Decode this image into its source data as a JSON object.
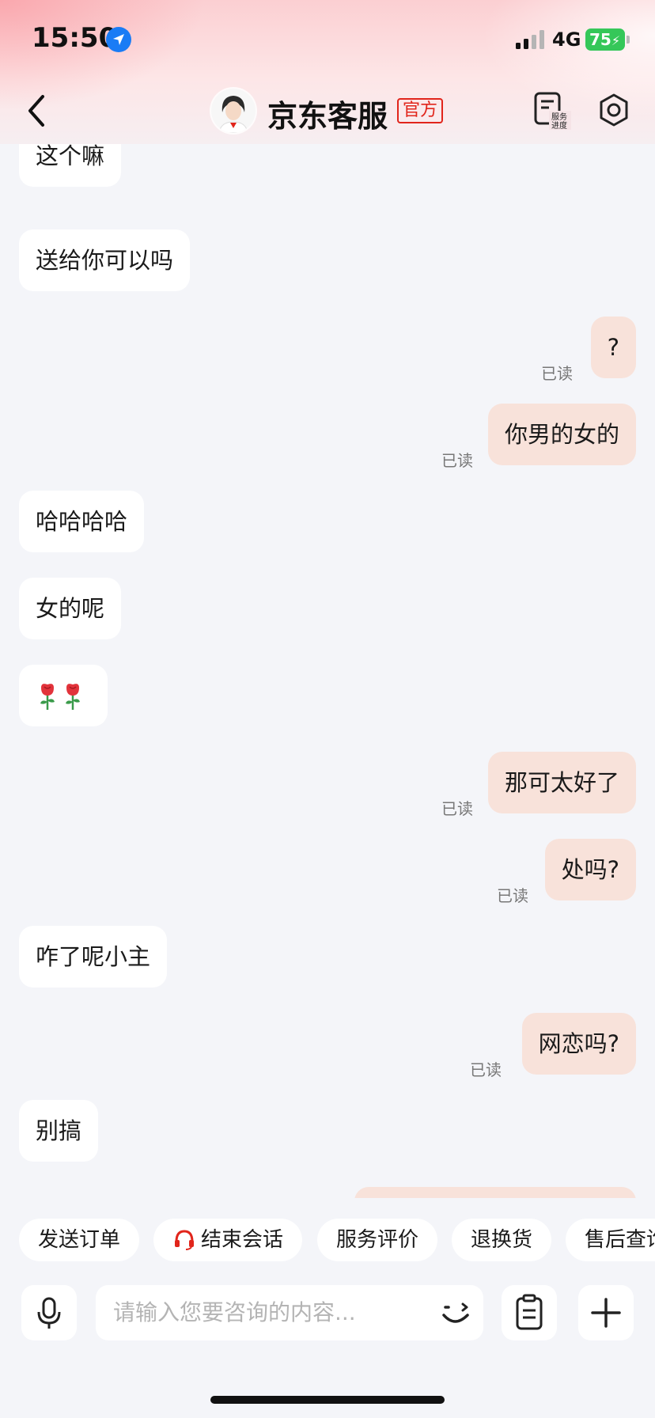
{
  "status_bar": {
    "time": "15:50",
    "network": "4G",
    "battery": "75"
  },
  "header": {
    "title": "京东客服",
    "badge": "官方"
  },
  "messages": [
    {
      "text": "这个嘛"
    },
    {
      "text": "送给你可以吗"
    },
    {
      "text": "?",
      "read": "已读"
    },
    {
      "text": "你男的女的",
      "read": "已读"
    },
    {
      "text": "哈哈哈哈"
    },
    {
      "text": "女的呢"
    },
    {
      "text": "那可太好了",
      "read": "已读"
    },
    {
      "text": "处吗?",
      "read": "已读"
    },
    {
      "text": "咋了呢小主"
    },
    {
      "text": "网恋吗?",
      "read": "已读"
    },
    {
      "text": "别搞"
    }
  ],
  "quick_actions": [
    "发送订单",
    "结束会话",
    "服务评价",
    "退换货",
    "售后查询"
  ],
  "input": {
    "placeholder": "请输入您要咨询的内容..."
  },
  "colors": {
    "accent": "#e1251b",
    "outgoing_bubble": "#f8e2da",
    "incoming_bubble": "#ffffff",
    "background": "#f4f5f9"
  }
}
